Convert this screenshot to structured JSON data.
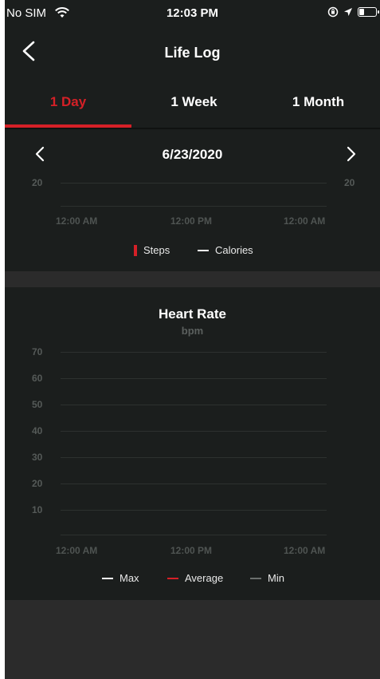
{
  "status_bar": {
    "carrier": "No SIM",
    "time": "12:03 PM",
    "icons": [
      "wifi-icon",
      "orientation-lock-icon",
      "location-arrow-icon",
      "battery-icon"
    ]
  },
  "nav": {
    "title": "Life Log",
    "back_icon": "chevron-left-icon"
  },
  "tabs": [
    {
      "label": "1 Day",
      "active": true
    },
    {
      "label": "1 Week",
      "active": false
    },
    {
      "label": "1 Month",
      "active": false
    }
  ],
  "activity_chart": {
    "date": "6/23/2020",
    "prev_icon": "chevron-left-icon",
    "next_icon": "chevron-right-icon",
    "left_axis_label": "20",
    "right_axis_label": "20",
    "x_ticks": [
      "12:00 AM",
      "12:00 PM",
      "12:00 AM"
    ],
    "legend": [
      {
        "label": "Steps",
        "color": "#d52027",
        "style": "bar"
      },
      {
        "label": "Calories",
        "color": "#ffffff",
        "style": "line"
      }
    ]
  },
  "heart_rate_chart": {
    "title": "Heart Rate",
    "unit": "bpm",
    "y_ticks": [
      "70",
      "60",
      "50",
      "40",
      "30",
      "20",
      "10"
    ],
    "x_ticks": [
      "12:00 AM",
      "12:00 PM",
      "12:00 AM"
    ],
    "legend": [
      {
        "label": "Max",
        "color": "#ffffff"
      },
      {
        "label": "Average",
        "color": "#d52027"
      },
      {
        "label": "Min",
        "color": "#6b6f6d"
      }
    ]
  },
  "colors": {
    "accent": "#d52027",
    "background": "#1b1e1d",
    "separator": "#2b2b2b"
  },
  "chart_data": [
    {
      "type": "bar",
      "title": "",
      "series": [
        {
          "name": "Steps",
          "values": []
        },
        {
          "name": "Calories",
          "values": []
        }
      ],
      "x_ticks": [
        "12:00 AM",
        "12:00 PM",
        "12:00 AM"
      ],
      "y_ticks": [
        "20"
      ]
    },
    {
      "type": "line",
      "title": "Heart Rate",
      "ylabel": "bpm",
      "series": [
        {
          "name": "Max",
          "values": []
        },
        {
          "name": "Average",
          "values": []
        },
        {
          "name": "Min",
          "values": []
        }
      ],
      "x_ticks": [
        "12:00 AM",
        "12:00 PM",
        "12:00 AM"
      ],
      "y_ticks": [
        70,
        60,
        50,
        40,
        30,
        20,
        10
      ]
    }
  ]
}
